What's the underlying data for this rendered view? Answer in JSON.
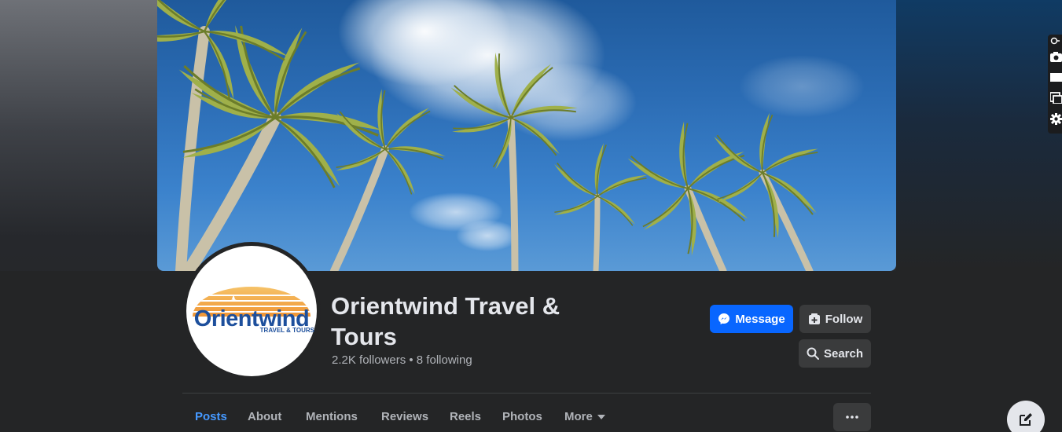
{
  "profile": {
    "name": "Orientwind Travel & Tours",
    "stats": "2.2K followers • 8 following",
    "logo": {
      "word": "Orientwind",
      "tagline": "TRAVEL & TOURS"
    }
  },
  "actions": {
    "message_label": "Message",
    "follow_label": "Follow",
    "search_label": "Search"
  },
  "tabs": [
    {
      "label": "Posts",
      "active": true
    },
    {
      "label": "About"
    },
    {
      "label": "Mentions"
    },
    {
      "label": "Reviews"
    },
    {
      "label": "Reels"
    },
    {
      "label": "Photos"
    },
    {
      "label": "More"
    }
  ],
  "icons": {
    "messenger": "messenger-icon",
    "follow": "follow-icon",
    "search": "search-icon",
    "more_options": "ellipsis-icon",
    "compose": "compose-icon",
    "edge_toolbar": [
      "pin-icon",
      "camera-icon",
      "rectangle-icon",
      "window-icon",
      "gear-icon"
    ]
  },
  "colors": {
    "accent": "#0866ff",
    "active_tab": "#4599ff",
    "logo_blue": "#1d4f9c",
    "logo_sun": "#f2a240"
  }
}
